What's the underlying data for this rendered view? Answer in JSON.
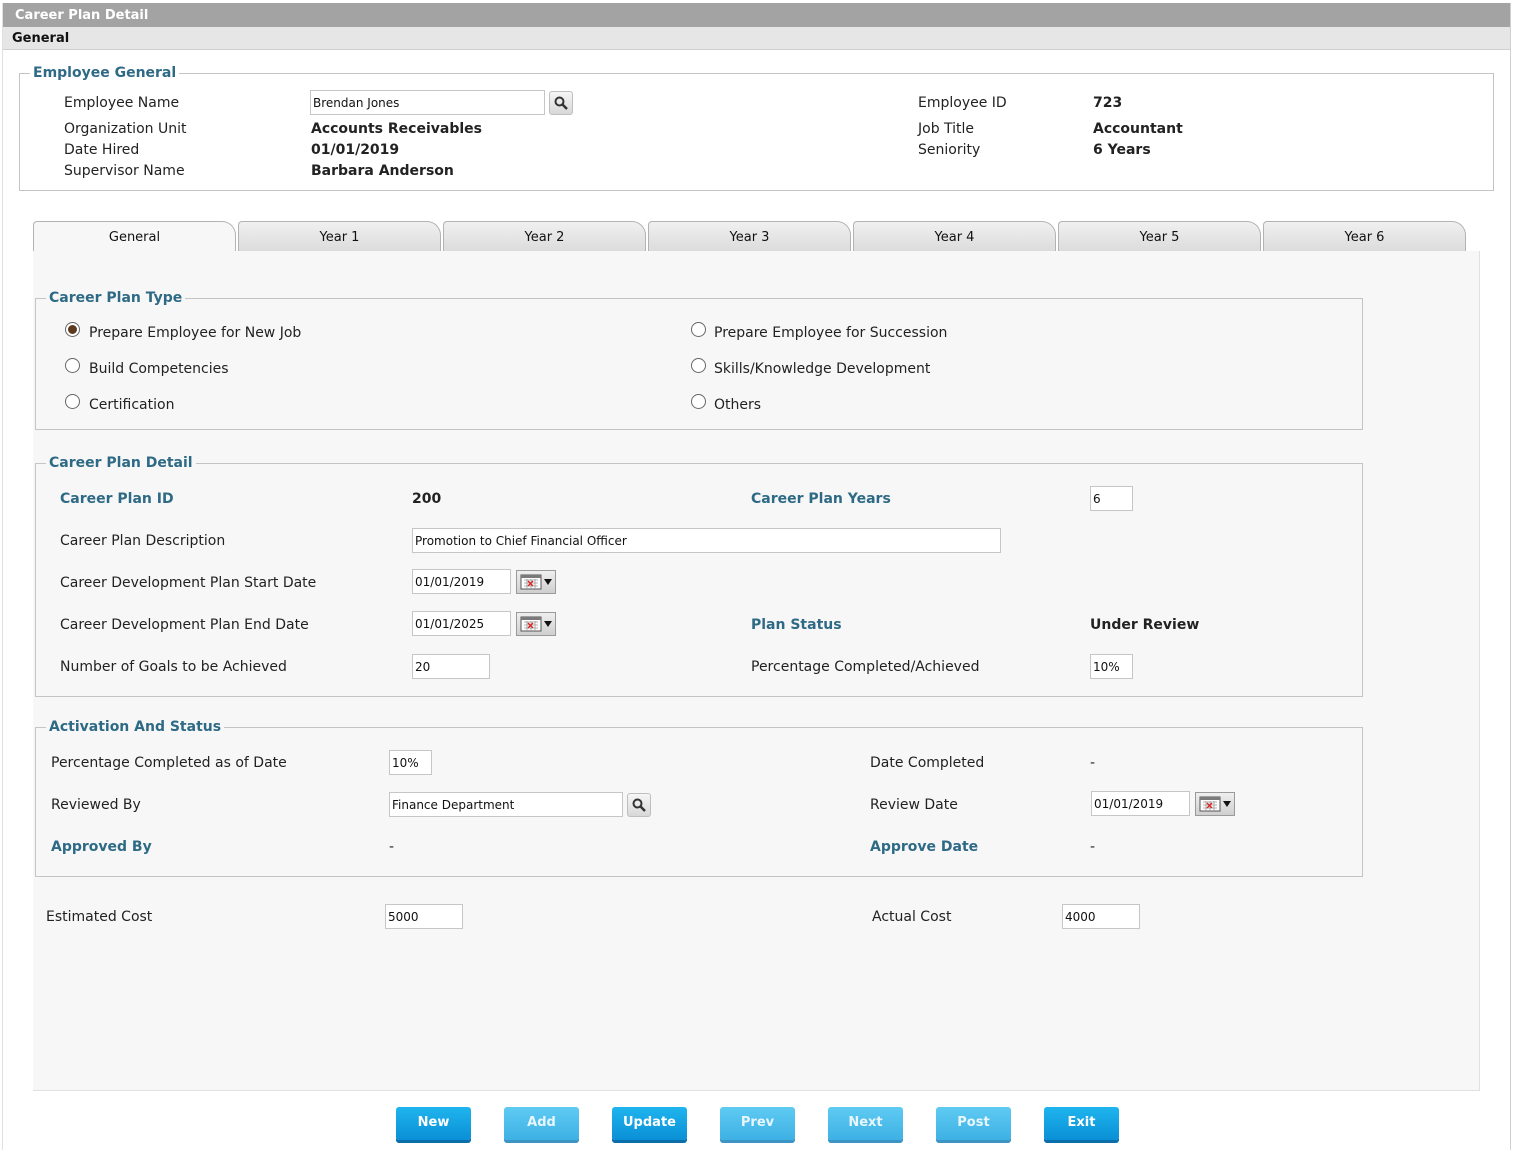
{
  "window": {
    "title": "Career Plan Detail",
    "section": "General"
  },
  "employee_general": {
    "legend": "Employee General",
    "employee_name_label": "Employee Name",
    "employee_name_value": "Brendan Jones",
    "org_unit_label": "Organization Unit",
    "org_unit_value": "Accounts Receivables",
    "date_hired_label": "Date Hired",
    "date_hired_value": "01/01/2019",
    "supervisor_label": "Supervisor Name",
    "supervisor_value": "Barbara Anderson",
    "employee_id_label": "Employee ID",
    "employee_id_value": "723",
    "job_title_label": "Job Title",
    "job_title_value": "Accountant",
    "seniority_label": "Seniority",
    "seniority_value": "6 Years"
  },
  "tabs": [
    {
      "label": "General",
      "active": true
    },
    {
      "label": "Year 1"
    },
    {
      "label": "Year 2"
    },
    {
      "label": "Year 3"
    },
    {
      "label": "Year 4"
    },
    {
      "label": "Year 5"
    },
    {
      "label": "Year 6"
    }
  ],
  "career_plan_type": {
    "legend": "Career Plan Type",
    "options": [
      {
        "label": "Prepare Employee for New Job",
        "selected": true
      },
      {
        "label": "Prepare Employee for Succession",
        "selected": false
      },
      {
        "label": "Build Competencies",
        "selected": false
      },
      {
        "label": "Skills/Knowledge Development",
        "selected": false
      },
      {
        "label": "Certification",
        "selected": false
      },
      {
        "label": "Others",
        "selected": false
      }
    ]
  },
  "career_plan_detail": {
    "legend": "Career Plan Detail",
    "plan_id_label": "Career Plan ID",
    "plan_id_value": "200",
    "plan_years_label": "Career Plan Years",
    "plan_years_value": "6",
    "description_label": "Career Plan Description",
    "description_value": "Promotion to Chief Financial Officer",
    "start_date_label": "Career Development Plan Start Date",
    "start_date_value": "01/01/2019",
    "end_date_label": "Career Development Plan End Date",
    "end_date_value": "01/01/2025",
    "plan_status_label": "Plan Status",
    "plan_status_value": "Under Review",
    "goals_label": "Number of Goals to be Achieved",
    "goals_value": "20",
    "pct_label": "Percentage Completed/Achieved",
    "pct_value": "10%"
  },
  "activation": {
    "legend": "Activation And Status",
    "pct_date_label": "Percentage Completed as of Date",
    "pct_date_value": "10%",
    "date_completed_label": "Date Completed",
    "date_completed_value": "-",
    "reviewed_by_label": "Reviewed By",
    "reviewed_by_value": "Finance Department",
    "review_date_label": "Review Date",
    "review_date_value": "01/01/2019",
    "approved_by_label": "Approved By",
    "approved_by_value": "-",
    "approve_date_label": "Approve Date",
    "approve_date_value": "-"
  },
  "costs": {
    "estimated_label": "Estimated Cost",
    "estimated_value": "5000",
    "actual_label": "Actual Cost",
    "actual_value": "4000"
  },
  "buttons": {
    "new": "New",
    "add": "Add",
    "update": "Update",
    "prev": "Prev",
    "next": "Next",
    "post": "Post",
    "exit": "Exit"
  }
}
